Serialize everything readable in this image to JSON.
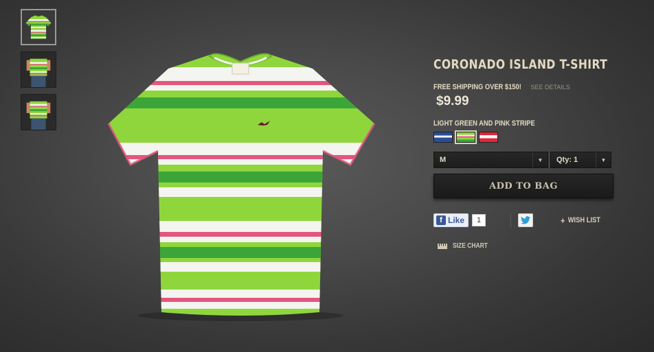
{
  "product": {
    "title": "CORONADO ISLAND T-SHIRT",
    "shipping_text": "FREE SHIPPING OVER $150!",
    "shipping_link": "SEE DETAILS",
    "price": "$9.99",
    "color_name": "LIGHT GREEN AND PINK STRIPE",
    "brand_logo_text": "HOLLISTER"
  },
  "swatches": [
    {
      "name": "blue stripe",
      "color": "#2a4d9a"
    },
    {
      "name": "light green and pink stripe",
      "color": "#8dd43c",
      "selected": true
    },
    {
      "name": "red stripe",
      "color": "#e0273a"
    }
  ],
  "size_select": {
    "value": "M"
  },
  "qty_select": {
    "value": "Qty: 1"
  },
  "add_to_bag": {
    "label": "ADD TO BAG"
  },
  "social": {
    "fb_icon": "f",
    "fb_like_label": "Like",
    "fb_like_count": "1",
    "wish_list_label": "WISH LIST",
    "wish_list_prefix": "+"
  },
  "size_chart": {
    "label": "SIZE CHART",
    "icon": "ruler-icon"
  },
  "thumbnails": [
    {
      "name": "front-view",
      "active": true
    },
    {
      "name": "model-front-view"
    },
    {
      "name": "model-back-view"
    }
  ],
  "colors": {
    "shirt_green": "#8fd63c",
    "shirt_dark_green": "#3ba53a",
    "shirt_pink": "#e4567f",
    "text_cream": "#e3d9c2"
  }
}
